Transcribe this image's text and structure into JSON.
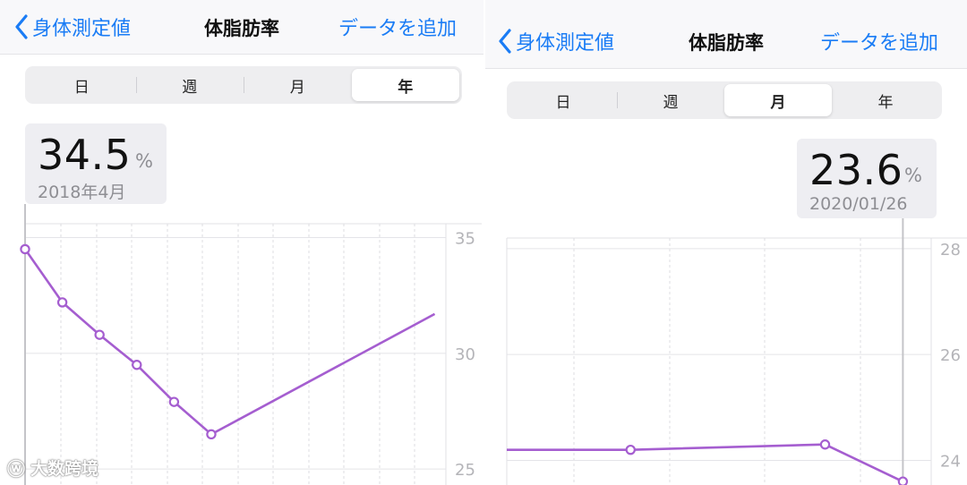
{
  "left": {
    "nav": {
      "back_label": "身体測定値",
      "title": "体脂肪率",
      "action_label": "データを追加"
    },
    "segments": [
      {
        "label": "日",
        "active": false
      },
      {
        "label": "週",
        "active": false
      },
      {
        "label": "月",
        "active": false
      },
      {
        "label": "年",
        "active": true
      }
    ],
    "selection": {
      "value": "34.5",
      "unit": "%",
      "date": "2018年4月"
    },
    "chart_data": {
      "type": "line",
      "y_ticks": [
        "35",
        "30",
        "25"
      ],
      "ylim": [
        24,
        35.6
      ],
      "grid": true,
      "series": [
        {
          "color": "#a55ed0",
          "points": [
            [
              0,
              34.5
            ],
            [
              1,
              32.2
            ],
            [
              2,
              30.8
            ],
            [
              3,
              29.5
            ],
            [
              4,
              27.9
            ],
            [
              5,
              26.5
            ],
            [
              11,
              31.7
            ]
          ],
          "markers": [
            0,
            1,
            2,
            3,
            4,
            5
          ]
        }
      ],
      "x_slots": 11.3,
      "selected_index": 0
    }
  },
  "right": {
    "nav": {
      "back_label": "身体測定値",
      "title": "体脂肪率",
      "action_label": "データを追加"
    },
    "segments": [
      {
        "label": "日",
        "active": false
      },
      {
        "label": "週",
        "active": false
      },
      {
        "label": "月",
        "active": true
      },
      {
        "label": "年",
        "active": false
      }
    ],
    "selection": {
      "value": "23.6",
      "unit": "%",
      "date": "2020/01/26"
    },
    "chart_data": {
      "type": "line",
      "y_ticks": [
        "28",
        "26",
        "24"
      ],
      "ylim": [
        23.4,
        28.2
      ],
      "grid": true,
      "series": [
        {
          "color": "#a55ed0",
          "points": [
            [
              0,
              24.2
            ],
            [
              3.5,
              24.2
            ],
            [
              9,
              24.3
            ],
            [
              11.2,
              23.6
            ]
          ],
          "markers": [
            1,
            2,
            3
          ]
        }
      ],
      "x_slots": 12.0,
      "selected_index": 3
    }
  },
  "watermark": {
    "text": "大数跨境",
    "icon": "weibo-logo-icon"
  }
}
